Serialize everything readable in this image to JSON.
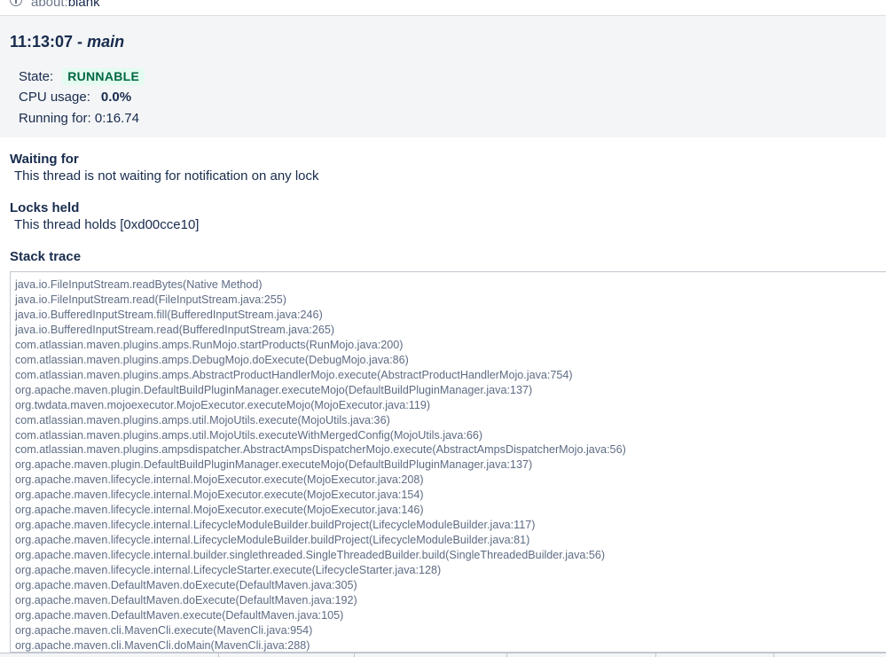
{
  "browser": {
    "url_scheme": "about:",
    "url_host": "blank"
  },
  "thread": {
    "time": "11:13:07 - ",
    "name": "main",
    "state_label": "State:",
    "state_value": "RUNNABLE",
    "cpu_label": "CPU usage:",
    "cpu_value": "0.0%",
    "running_label": "Running for:",
    "running_value": "0:16.74"
  },
  "waiting": {
    "heading": "Waiting for",
    "text": "This thread is not waiting for notification on any lock"
  },
  "locks": {
    "heading": "Locks held",
    "text": "This thread holds [0xd00cce10]"
  },
  "stack": {
    "heading": "Stack trace",
    "frames": [
      "java.io.FileInputStream.readBytes(Native Method)",
      "java.io.FileInputStream.read(FileInputStream.java:255)",
      "java.io.BufferedInputStream.fill(BufferedInputStream.java:246)",
      "java.io.BufferedInputStream.read(BufferedInputStream.java:265)",
      "com.atlassian.maven.plugins.amps.RunMojo.startProducts(RunMojo.java:200)",
      "com.atlassian.maven.plugins.amps.DebugMojo.doExecute(DebugMojo.java:86)",
      "com.atlassian.maven.plugins.amps.AbstractProductHandlerMojo.execute(AbstractProductHandlerMojo.java:754)",
      "org.apache.maven.plugin.DefaultBuildPluginManager.executeMojo(DefaultBuildPluginManager.java:137)",
      "org.twdata.maven.mojoexecutor.MojoExecutor.executeMojo(MojoExecutor.java:119)",
      "com.atlassian.maven.plugins.amps.util.MojoUtils.execute(MojoUtils.java:36)",
      "com.atlassian.maven.plugins.amps.util.MojoUtils.executeWithMergedConfig(MojoUtils.java:66)",
      "com.atlassian.maven.plugins.ampsdispatcher.AbstractAmpsDispatcherMojo.execute(AbstractAmpsDispatcherMojo.java:56)",
      "org.apache.maven.plugin.DefaultBuildPluginManager.executeMojo(DefaultBuildPluginManager.java:137)",
      "org.apache.maven.lifecycle.internal.MojoExecutor.execute(MojoExecutor.java:208)",
      "org.apache.maven.lifecycle.internal.MojoExecutor.execute(MojoExecutor.java:154)",
      "org.apache.maven.lifecycle.internal.MojoExecutor.execute(MojoExecutor.java:146)",
      "org.apache.maven.lifecycle.internal.LifecycleModuleBuilder.buildProject(LifecycleModuleBuilder.java:117)",
      "org.apache.maven.lifecycle.internal.LifecycleModuleBuilder.buildProject(LifecycleModuleBuilder.java:81)",
      "org.apache.maven.lifecycle.internal.builder.singlethreaded.SingleThreadedBuilder.build(SingleThreadedBuilder.java:56)",
      "org.apache.maven.lifecycle.internal.LifecycleStarter.execute(LifecycleStarter.java:128)",
      "org.apache.maven.DefaultMaven.doExecute(DefaultMaven.java:305)",
      "org.apache.maven.DefaultMaven.doExecute(DefaultMaven.java:192)",
      "org.apache.maven.DefaultMaven.execute(DefaultMaven.java:105)",
      "org.apache.maven.cli.MavenCli.execute(MavenCli.java:954)",
      "org.apache.maven.cli.MavenCli.doMain(MavenCli.java:288)"
    ]
  },
  "colors": {
    "header_bg": "#f4f5f7",
    "text": "#172b4d",
    "muted_text": "#5e6c84",
    "badge_bg": "#e3fcef",
    "badge_text": "#006644"
  }
}
